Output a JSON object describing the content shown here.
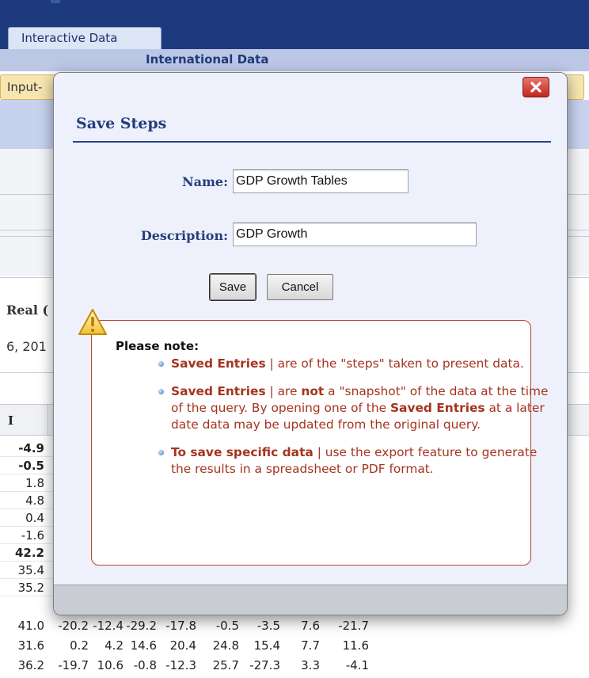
{
  "app": {
    "tab_label": "Interactive Data",
    "section_title": "International Data",
    "input_bar_text": "Input-",
    "real_label": "Real (",
    "date_label": "6, 201",
    "table_header_first": "I"
  },
  "background_rows": [
    {
      "value": "-4.9",
      "bold": true
    },
    {
      "value": "-0.5",
      "bold": true
    },
    {
      "value": "1.8",
      "bold": false
    },
    {
      "value": "4.8",
      "bold": false
    },
    {
      "value": "0.4",
      "bold": false
    },
    {
      "value": "-1.6",
      "bold": false
    },
    {
      "value": "42.2",
      "bold": true
    },
    {
      "value": "35.4",
      "bold": false
    },
    {
      "value": "35.2",
      "bold": false
    }
  ],
  "bottom_rows": [
    [
      "41.0",
      "-20.2",
      "-12.4",
      "-29.2",
      "-17.8",
      "-0.5",
      "-3.5",
      "7.6",
      "-21.7"
    ],
    [
      "31.6",
      "0.2",
      "4.2",
      "14.6",
      "20.4",
      "24.8",
      "15.4",
      "7.7",
      "11.6"
    ],
    [
      "36.2",
      "-19.7",
      "10.6",
      "-0.8",
      "-12.3",
      "25.7",
      "-27.3",
      "3.3",
      "-4.1"
    ]
  ],
  "dialog": {
    "title": "Save Steps",
    "name_label": "Name:",
    "name_value": "GDP Growth Tables",
    "description_label": "Description:",
    "description_value": "GDP Growth ",
    "save_label": "Save",
    "cancel_label": "Cancel",
    "close_icon": "close-x-icon",
    "warning_icon": "warning-triangle-icon",
    "note_heading": "Please note:",
    "notes": [
      {
        "parts": [
          {
            "text": "Saved Entries",
            "bold": true
          },
          {
            "text": " | are of the \"steps\" taken to present data.",
            "bold": false
          }
        ]
      },
      {
        "parts": [
          {
            "text": "Saved Entries",
            "bold": true
          },
          {
            "text": " | are ",
            "bold": false
          },
          {
            "text": "not",
            "bold": true
          },
          {
            "text": " a \"snapshot\" of the data at the time of the query. By opening one of the ",
            "bold": false
          },
          {
            "text": "Saved Entries",
            "bold": true
          },
          {
            "text": " at a later date data may be updated from the original query.",
            "bold": false
          }
        ]
      },
      {
        "parts": [
          {
            "text": "To save specific data",
            "bold": true
          },
          {
            "text": " | use the export feature to generate the results in a spreadsheet or PDF format.",
            "bold": false
          }
        ]
      }
    ]
  },
  "colors": {
    "header_navy": "#1d3a7e",
    "dialog_title": "#243e7c",
    "note_text": "#a5341f",
    "note_border": "#b8432d",
    "close_red": "#c0281d"
  }
}
